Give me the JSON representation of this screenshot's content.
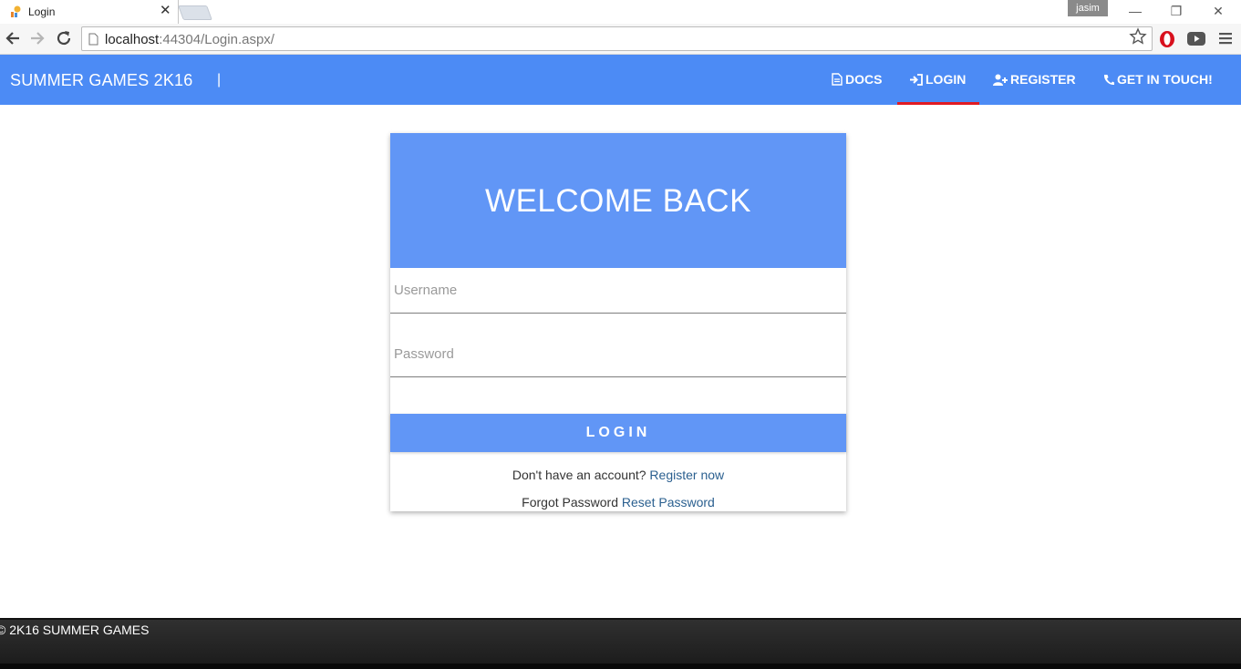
{
  "browser": {
    "tab_title": "Login",
    "profile_name": "jasim",
    "url_host": "localhost",
    "url_rest": ":44304/Login.aspx/"
  },
  "nav": {
    "brand": "SUMMER GAMES 2K16",
    "separator": "|",
    "items": [
      {
        "label": "DOCS",
        "icon": "file-icon"
      },
      {
        "label": "LOGIN",
        "icon": "sign-in-icon",
        "active": true
      },
      {
        "label": "REGISTER",
        "icon": "user-plus-icon"
      },
      {
        "label": "GET IN TOUCH!",
        "icon": "phone-icon"
      }
    ],
    "active_color": "#e11b22",
    "bar_color": "#4c8bf5"
  },
  "login": {
    "title": "WELCOME BACK",
    "username_placeholder": "Username",
    "password_placeholder": "Password",
    "button_label": "LOGIN",
    "register_prompt": "Don't have an account?",
    "register_link": "Register now",
    "forgot_prompt": "Forgot Password",
    "reset_link": "Reset Password"
  },
  "footer": {
    "copyright": "© 2K16 SUMMER GAMES"
  }
}
